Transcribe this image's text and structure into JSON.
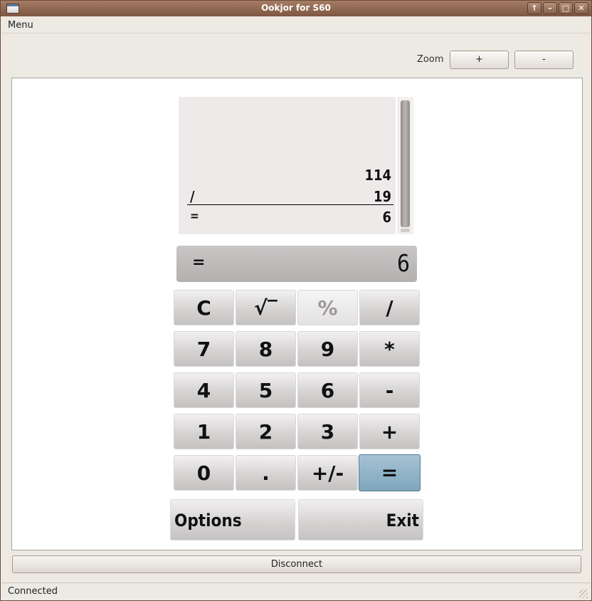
{
  "window": {
    "title": "Ookjor for S60",
    "controls": [
      "↑",
      "–",
      "□",
      "✕"
    ]
  },
  "menubar": {
    "menu_label": "Menu"
  },
  "zoom": {
    "label": "Zoom",
    "plus_label": "+",
    "minus_label": "-"
  },
  "history": {
    "operand1": "114",
    "operator": "/",
    "operand2": "19",
    "result_sign": "=",
    "result": "6"
  },
  "display": {
    "operator": "=",
    "value": "6"
  },
  "keypad": {
    "rows": [
      [
        "C",
        "√‾",
        "%",
        "/"
      ],
      [
        "7",
        "8",
        "9",
        "*"
      ],
      [
        "4",
        "5",
        "6",
        "-"
      ],
      [
        "1",
        "2",
        "3",
        "+"
      ],
      [
        "0",
        ".",
        "+/-",
        "="
      ]
    ],
    "disabled": [
      "%"
    ],
    "highlighted": [
      "="
    ]
  },
  "softkeys": {
    "left": "Options",
    "right": "Exit"
  },
  "disconnect_label": "Disconnect",
  "status": "Connected"
}
